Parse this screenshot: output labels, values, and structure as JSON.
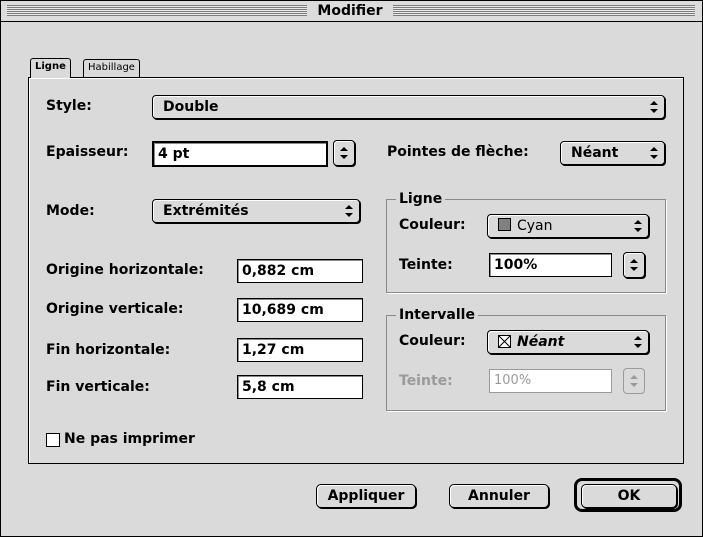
{
  "window": {
    "title": "Modifier"
  },
  "tabs": [
    {
      "label": "Ligne",
      "active": true
    },
    {
      "label": "Habillage",
      "active": false
    }
  ],
  "style": {
    "label": "Style:",
    "value": "Double"
  },
  "epaisseur": {
    "label": "Epaisseur:",
    "value": "4 pt"
  },
  "pointes": {
    "label": "Pointes de flèche:",
    "value": "Néant"
  },
  "mode": {
    "label": "Mode:",
    "value": "Extrémités"
  },
  "origine_h": {
    "label": "Origine horizontale:",
    "value": "0,882 cm"
  },
  "origine_v": {
    "label": "Origine verticale:",
    "value": "10,689 cm"
  },
  "fin_h": {
    "label": "Fin horizontale:",
    "value": "1,27 cm"
  },
  "fin_v": {
    "label": "Fin verticale:",
    "value": "5,8 cm"
  },
  "ligne_group": {
    "title": "Ligne",
    "couleur_label": "Couleur:",
    "couleur_value": "Cyan",
    "teinte_label": "Teinte:",
    "teinte_value": "100%"
  },
  "intervalle_group": {
    "title": "Intervalle",
    "couleur_label": "Couleur:",
    "couleur_value": "Néant",
    "teinte_label": "Teinte:",
    "teinte_value": "100%",
    "teinte_enabled": false
  },
  "print_checkbox": {
    "label": "Ne pas imprimer",
    "checked": false
  },
  "buttons": {
    "apply": "Appliquer",
    "cancel": "Annuler",
    "ok": "OK"
  },
  "colors": {
    "background": "#dadada",
    "swatch_cyan": "#808080"
  }
}
